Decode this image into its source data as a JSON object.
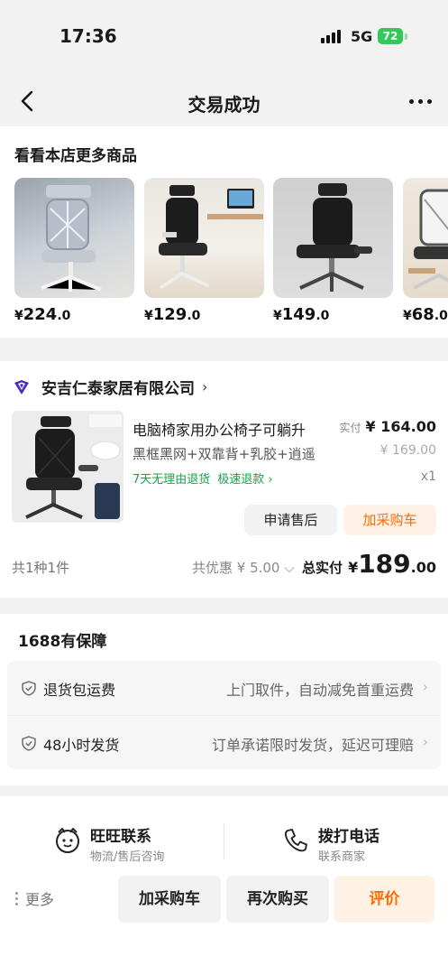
{
  "status_bar": {
    "time": "17:36",
    "network": "5G",
    "battery": "72"
  },
  "nav": {
    "title": "交易成功"
  },
  "recommend": {
    "title": "看看本店更多商品",
    "items": [
      {
        "price_symbol": "¥",
        "price_int": "224",
        "price_dec": ".0"
      },
      {
        "price_symbol": "¥",
        "price_int": "129",
        "price_dec": ".0"
      },
      {
        "price_symbol": "¥",
        "price_int": "149",
        "price_dec": ".0"
      },
      {
        "price_symbol": "¥",
        "price_int": "68",
        "price_dec": ".0"
      }
    ]
  },
  "order": {
    "shop_name": "安吉仁泰家居有限公司",
    "product_title": "电脑椅家用办公椅子可躺升",
    "product_spec": "黑框黑网+双靠背+乳胶+逍遥",
    "tag_return": "7天无理由退货",
    "tag_refund": "极速退款",
    "paid_label": "实付",
    "paid_value": "¥ 164.00",
    "original_price": "¥ 169.00",
    "quantity": "x1",
    "btn_after_sale": "申请售后",
    "btn_add_cart": "加采购车",
    "summary_count": "共1种1件",
    "summary_discount": "共优惠 ¥ 5.00",
    "summary_total_label": "总实付",
    "summary_total_symbol": "¥",
    "summary_total_int": "189",
    "summary_total_dec": ".00"
  },
  "guarantee": {
    "title": "1688有保障",
    "rows": [
      {
        "label": "退货包运费",
        "desc": "上门取件，自动减免首重运费"
      },
      {
        "label": "48小时发货",
        "desc": "订单承诺限时发货，延迟可理赔"
      }
    ]
  },
  "bottom_bar": {
    "wangwang_title": "旺旺联系",
    "wangwang_sub": "物流/售后咨询",
    "phone_title": "拨打电话",
    "phone_sub": "联系商家",
    "more_label": "更多",
    "btn_add_cart": "加采购车",
    "btn_buy_again": "再次购买",
    "btn_review": "评价"
  },
  "colors": {
    "accent": "#ff6a00",
    "green": "#15a34a",
    "battery": "#34c759"
  }
}
